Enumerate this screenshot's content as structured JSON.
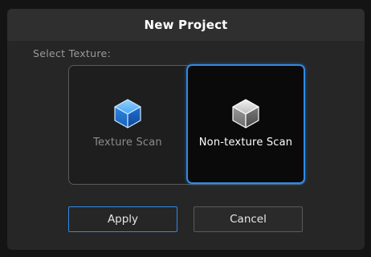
{
  "dialog": {
    "title": "New Project",
    "section_label": "Select Texture:",
    "options": [
      {
        "label": "Texture Scan",
        "icon": "cube-blue-icon",
        "selected": false
      },
      {
        "label": "Non-texture Scan",
        "icon": "cube-gray-icon",
        "selected": true
      }
    ],
    "buttons": {
      "apply": "Apply",
      "cancel": "Cancel"
    }
  },
  "colors": {
    "accent": "#2f8ae6",
    "background": "#262626",
    "title_bar": "#2f2f2f"
  }
}
